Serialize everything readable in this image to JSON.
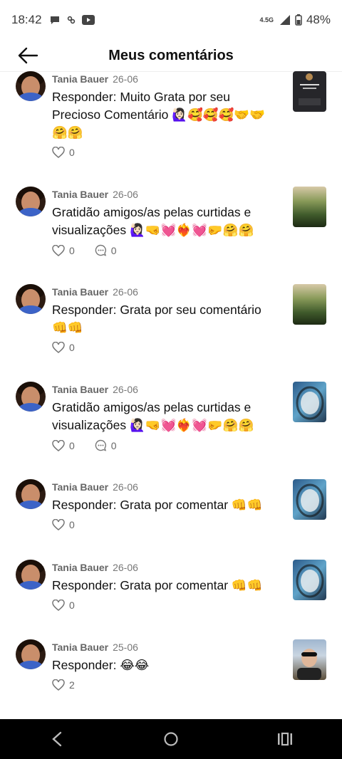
{
  "status": {
    "time": "18:42",
    "network": "4.5G",
    "battery": "48%"
  },
  "header": {
    "title": "Meus comentários"
  },
  "comments": [
    {
      "name": "Tania Bauer",
      "date": "26-06",
      "text": "Responder: Muito Grata por seu Precioso Comentário 🙋🏻‍♀️🥰🥰🥰🤝🤝🤗🤗",
      "likes": "0",
      "replies": null,
      "thumb": "dark"
    },
    {
      "name": "Tania Bauer",
      "date": "26-06",
      "text": "Gratidão amigos/as pelas curtidas e visualizações 🙋🏻‍♀️🤜💓❤️‍🔥💓🤛🤗🤗",
      "likes": "0",
      "replies": "0",
      "thumb": "landscape"
    },
    {
      "name": "Tania Bauer",
      "date": "26-06",
      "text": "Responder: Grata por seu comentário 👊👊",
      "likes": "0",
      "replies": null,
      "thumb": "landscape"
    },
    {
      "name": "Tania Bauer",
      "date": "26-06",
      "text": "Gratidão amigos/as pelas curtidas e visualizações 🙋🏻‍♀️🤜💓❤️‍🔥💓🤛🤗🤗",
      "likes": "0",
      "replies": "0",
      "thumb": "water"
    },
    {
      "name": "Tania Bauer",
      "date": "26-06",
      "text": "Responder: Grata por comentar 👊👊",
      "likes": "0",
      "replies": null,
      "thumb": "water"
    },
    {
      "name": "Tania Bauer",
      "date": "26-06",
      "text": "Responder: Grata por comentar 👊👊",
      "likes": "0",
      "replies": null,
      "thumb": "water"
    },
    {
      "name": "Tania Bauer",
      "date": "25-06",
      "text": "Responder: 😂😂",
      "likes": "2",
      "replies": null,
      "thumb": "selfie"
    }
  ]
}
